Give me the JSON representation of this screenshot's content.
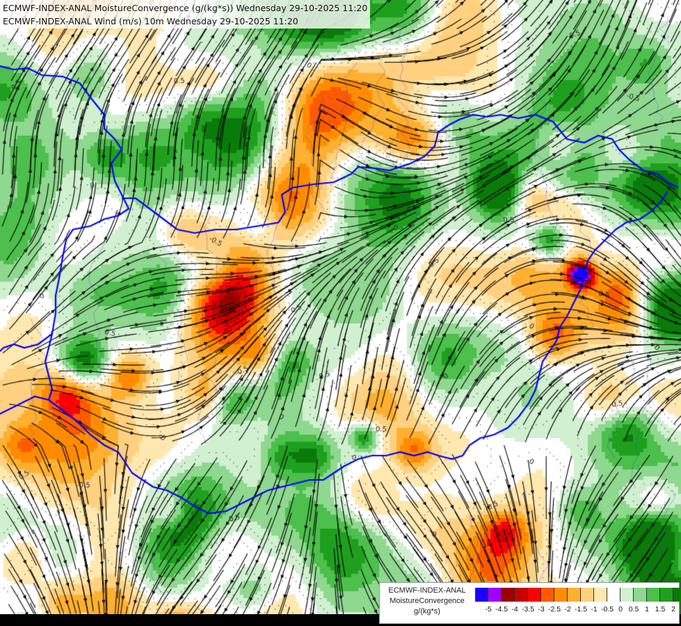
{
  "header": {
    "line1": "ECMWF-INDEX-ANAL MoistureConvergence (g/(kg*s)) Wednesday 29-10-2025 11:20",
    "line2": "ECMWF-INDEX-ANAL Wind (m/s) 10m Wednesday 29-10-2025 11:20"
  },
  "legend": {
    "title_line1": "ECMWF-INDEX-ANAL",
    "title_line2": "MoistureConvergence",
    "title_line3": "g/(kg*s)",
    "ticks": [
      "-5",
      "-4.5",
      "-4",
      "-3.5",
      "-3",
      "-2.5",
      "-2",
      "-1.5",
      "-1",
      "-0.5",
      "0",
      "0.5",
      "1",
      "1.5",
      "2"
    ],
    "colors": [
      "#1e00ff",
      "#a000ff",
      "#9a0000",
      "#c80000",
      "#ff0000",
      "#ff5a00",
      "#ff8c00",
      "#ffb030",
      "#ffd080",
      "#ffe8b0",
      "#ffffff",
      "#d0f0d0",
      "#8fd88f",
      "#4cbf4c",
      "#1ea01e",
      "#0a7a0a"
    ]
  },
  "map": {
    "contour_labels": [
      "0.5",
      "0",
      "-0.5",
      "0.5",
      "0",
      "0.5",
      "-0.5",
      "0",
      "0.5",
      "0",
      "0.5",
      "-0.5",
      "0",
      "0.5",
      "0",
      "-0.5",
      "0.5",
      "0",
      "0.5",
      "0",
      "-0.5",
      "0.5",
      "0",
      "0.5",
      "0",
      "0.5",
      "-0.5",
      "0",
      "0.5",
      "0"
    ],
    "border_color": "#0000ff",
    "river_color": "#3333ff",
    "streamline_color": "#000000"
  }
}
